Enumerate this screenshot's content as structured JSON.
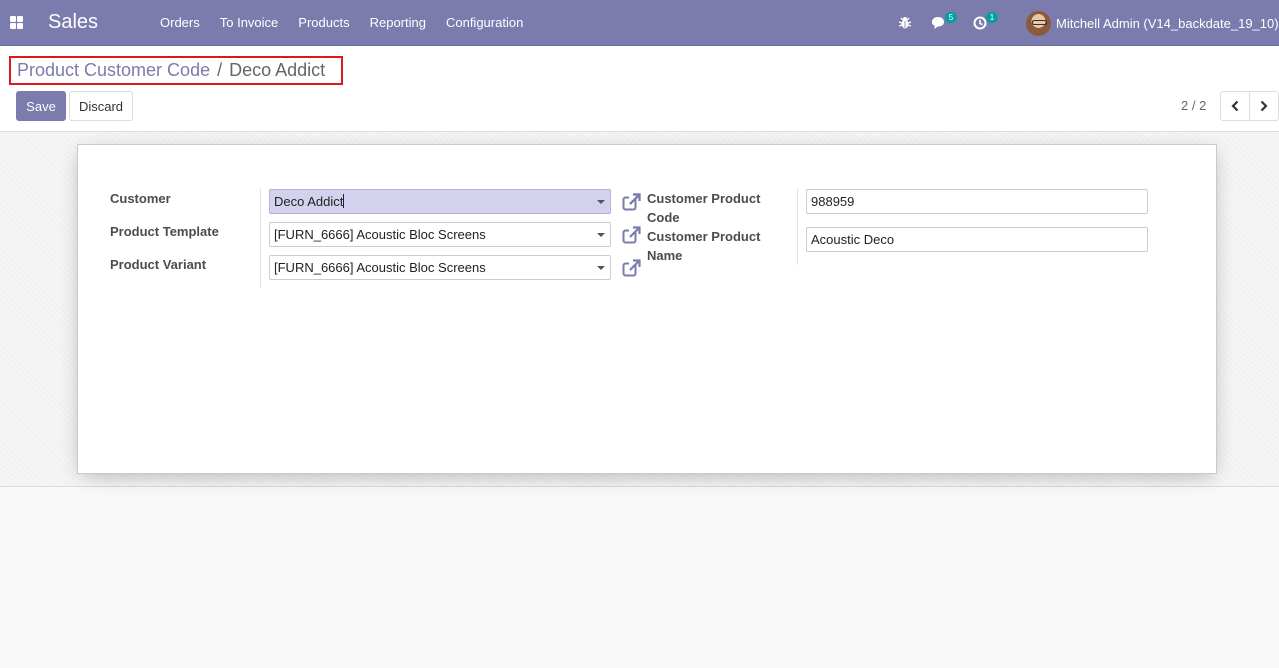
{
  "navbar": {
    "app_name": "Sales",
    "menu": [
      "Orders",
      "To Invoice",
      "Products",
      "Reporting",
      "Configuration"
    ],
    "messages_count": "5",
    "activities_count": "1",
    "user_name": "Mitchell Admin (V14_backdate_19_10)"
  },
  "breadcrumb": {
    "parent": "Product Customer Code",
    "separator": "/",
    "current": "Deco Addict"
  },
  "buttons": {
    "save": "Save",
    "discard": "Discard"
  },
  "pager": {
    "value": "2 / 2"
  },
  "form": {
    "customer_label": "Customer",
    "customer_value": "Deco Addict",
    "product_template_label": "Product Template",
    "product_template_value": "[FURN_6666] Acoustic Bloc Screens",
    "product_variant_label": "Product Variant",
    "product_variant_value": "[FURN_6666] Acoustic Bloc Screens",
    "customer_product_code_label_1": "Customer Product",
    "customer_product_code_label_2": "Code",
    "customer_product_code_value": "988959",
    "customer_product_name_label_1": "Customer Product",
    "customer_product_name_label_2": "Name",
    "customer_product_name_value": "Acoustic Deco"
  },
  "colors": {
    "brand": "#7c7bad",
    "focus_field": "#d2d1ee",
    "highlight_border": "#d9191a",
    "badge": "#00a09d"
  },
  "icons": [
    "apps-icon",
    "bug-icon",
    "chat-icon",
    "clock-icon",
    "external-link-icon",
    "chevron-left-icon",
    "chevron-right-icon",
    "caret-down-icon"
  ]
}
